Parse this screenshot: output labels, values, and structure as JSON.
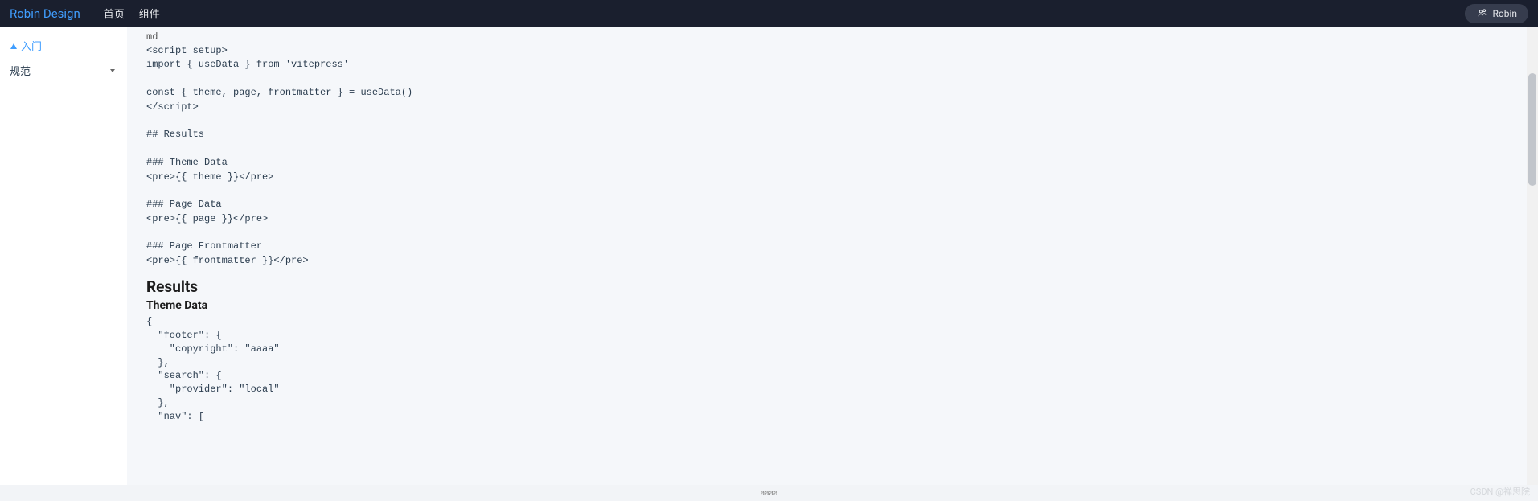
{
  "header": {
    "brand": "Robin Design",
    "nav": [
      {
        "label": "首页"
      },
      {
        "label": "组件"
      }
    ],
    "user": "Robin"
  },
  "sidebar": {
    "items": [
      {
        "label": "入门",
        "active": true,
        "hasIcon": true
      },
      {
        "label": "规范",
        "active": false,
        "hasChevron": true
      }
    ]
  },
  "content": {
    "md_label": "md",
    "code": "<script setup>\nimport { useData } from 'vitepress'\n\nconst { theme, page, frontmatter } = useData()\n</script>\n\n## Results\n\n### Theme Data\n<pre>{{ theme }}</pre>\n\n### Page Data\n<pre>{{ page }}</pre>\n\n### Page Frontmatter\n<pre>{{ frontmatter }}</pre>",
    "results_heading": "Results",
    "theme_data_heading": "Theme Data",
    "theme_json": "{\n  \"footer\": {\n    \"copyright\": \"aaaa\"\n  },\n  \"search\": {\n    \"provider\": \"local\"\n  },\n  \"nav\": ["
  },
  "footer": {
    "text": "aaaa"
  },
  "watermark": "CSDN @禅思院"
}
